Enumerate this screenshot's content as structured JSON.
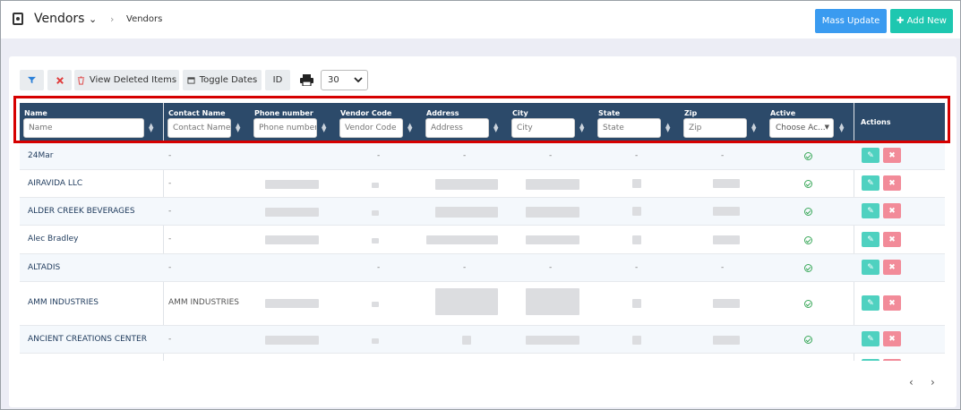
{
  "header": {
    "title": "Vendors",
    "breadcrumb": "Vendors",
    "mass_update": "Mass Update",
    "add_new": "Add New"
  },
  "toolbar": {
    "view_deleted": "View Deleted Items",
    "toggle_dates": "Toggle Dates",
    "id": "ID",
    "page_size": "30"
  },
  "columns": [
    {
      "label": "Name",
      "placeholder": "Name"
    },
    {
      "label": "Contact Name",
      "placeholder": "Contact Name"
    },
    {
      "label": "Phone number",
      "placeholder": "Phone number"
    },
    {
      "label": "Vendor Code",
      "placeholder": "Vendor Code"
    },
    {
      "label": "Address",
      "placeholder": "Address"
    },
    {
      "label": "City",
      "placeholder": "City"
    },
    {
      "label": "State",
      "placeholder": "State"
    },
    {
      "label": "Zip",
      "placeholder": "Zip"
    },
    {
      "label": "Active",
      "placeholder": "Choose Ac..."
    },
    {
      "label": "Actions"
    }
  ],
  "rows": [
    {
      "name": "24Mar",
      "contact": "-",
      "phone": "",
      "code": "-",
      "address": "-",
      "city": "-",
      "state": "-",
      "zip": "-",
      "active": true
    },
    {
      "name": "AIRAVIDA LLC",
      "contact": "-",
      "phone": "",
      "code": "",
      "address": "",
      "city": "",
      "state": "",
      "zip": "",
      "active": true
    },
    {
      "name": "ALDER CREEK BEVERAGES",
      "contact": "-",
      "phone": "",
      "code": "",
      "address": "",
      "city": "",
      "state": "",
      "zip": "",
      "active": true
    },
    {
      "name": "Alec Bradley",
      "contact": "-",
      "phone": "",
      "code": "",
      "address": "",
      "city": "",
      "state": "",
      "zip": "",
      "active": true
    },
    {
      "name": "ALTADIS",
      "contact": "-",
      "phone": "",
      "code": "-",
      "address": "-",
      "city": "-",
      "state": "-",
      "zip": "-",
      "active": true
    },
    {
      "name": "AMM INDUSTRIES",
      "contact": "AMM INDUSTRIES",
      "phone": "",
      "code": "",
      "address": "",
      "city": "",
      "state": "",
      "zip": "",
      "active": true
    },
    {
      "name": "ANCIENT CREATIONS CENTER",
      "contact": "-",
      "phone": "",
      "code": "",
      "address": "",
      "city": "",
      "state": "",
      "zip": "",
      "active": true
    }
  ]
}
